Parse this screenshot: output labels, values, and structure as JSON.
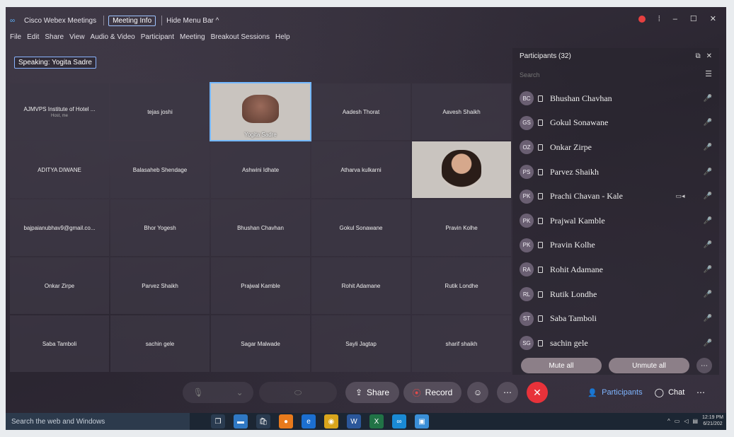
{
  "title_bar": {
    "app_title": "Cisco Webex Meetings",
    "meeting_info": "Meeting Info",
    "hide_menu": "Hide Menu Bar ^"
  },
  "menu": [
    "File",
    "Edit",
    "Share",
    "View",
    "Audio & Video",
    "Participant",
    "Meeting",
    "Breakout Sessions",
    "Help"
  ],
  "speaking": "Speaking: Yogita Sadre",
  "tiles": [
    {
      "name": "AJMVPS Institute of Hotel ...",
      "sub": "Host, me",
      "kind": "plain"
    },
    {
      "name": "tejas joshi",
      "kind": "plain"
    },
    {
      "name": "Yogita Sadre",
      "kind": "video-active"
    },
    {
      "name": "Aadesh Thorat",
      "kind": "plain"
    },
    {
      "name": "Aavesh Shaikh",
      "kind": "plain"
    },
    {
      "name": "ADITYA DIWANE",
      "kind": "plain"
    },
    {
      "name": "Balasaheb Shendage",
      "kind": "plain"
    },
    {
      "name": "Ashwini Idhate",
      "kind": "plain"
    },
    {
      "name": "Atharva kulkarni",
      "kind": "plain"
    },
    {
      "name": "",
      "kind": "video"
    },
    {
      "name": "bajpaianubhav9@gmail.co...",
      "kind": "plain"
    },
    {
      "name": "Bhor Yogesh",
      "kind": "plain"
    },
    {
      "name": "Bhushan Chavhan",
      "kind": "plain"
    },
    {
      "name": "Gokul Sonawane",
      "kind": "plain"
    },
    {
      "name": "Pravin Kolhe",
      "kind": "plain"
    },
    {
      "name": "Onkar Zirpe",
      "kind": "plain"
    },
    {
      "name": "Parvez Shaikh",
      "kind": "plain"
    },
    {
      "name": "Prajwal Kamble",
      "kind": "plain"
    },
    {
      "name": "Rohit Adamane",
      "kind": "plain"
    },
    {
      "name": "Rutik Londhe",
      "kind": "plain"
    },
    {
      "name": "Saba Tamboli",
      "kind": "plain"
    },
    {
      "name": "sachin gele",
      "kind": "plain"
    },
    {
      "name": "Sagar Malwade",
      "kind": "plain"
    },
    {
      "name": "Sayli Jagtap",
      "kind": "plain"
    },
    {
      "name": "sharif shaikh",
      "kind": "plain"
    }
  ],
  "participants": {
    "header": "Participants (32)",
    "search_placeholder": "Search",
    "list": [
      {
        "initials": "BC",
        "name": "Bhushan Chavhan"
      },
      {
        "initials": "GS",
        "name": "Gokul Sonawane"
      },
      {
        "initials": "OZ",
        "name": "Onkar Zirpe"
      },
      {
        "initials": "PS",
        "name": "Parvez Shaikh"
      },
      {
        "initials": "PK",
        "name": "Prachi Chavan - Kale",
        "camera": true
      },
      {
        "initials": "PK",
        "name": "Prajwal Kamble"
      },
      {
        "initials": "PK",
        "name": "Pravin Kolhe"
      },
      {
        "initials": "RA",
        "name": "Rohit Adamane"
      },
      {
        "initials": "RL",
        "name": "Rutik Londhe"
      },
      {
        "initials": "ST",
        "name": "Saba Tamboli"
      },
      {
        "initials": "SG",
        "name": "sachin gele"
      }
    ],
    "mute_all": "Mute all",
    "unmute_all": "Unmute all"
  },
  "controls": {
    "share": "Share",
    "record": "Record",
    "participants": "Participants",
    "chat": "Chat"
  },
  "taskbar": {
    "search": "Search the web and Windows",
    "time": "12:19 PM",
    "date": "6/21/202"
  },
  "colors": {
    "end_call": "#e8323a",
    "muted_mic": "#e24a4a",
    "active_outline": "#73b8ff"
  }
}
